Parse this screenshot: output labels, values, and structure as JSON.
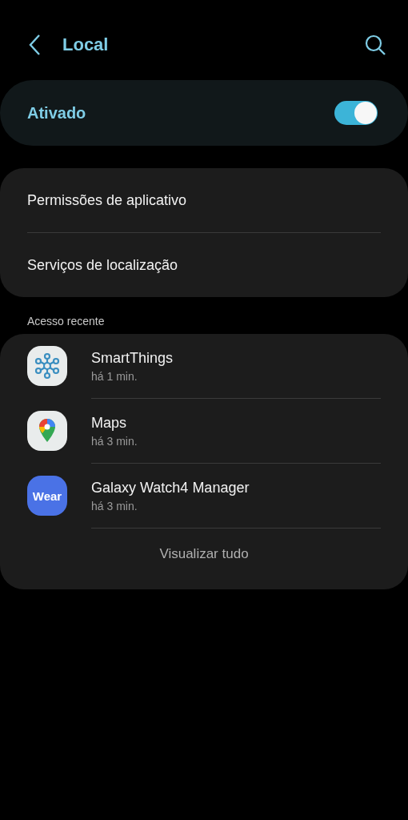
{
  "header": {
    "title": "Local"
  },
  "master": {
    "label": "Ativado",
    "on": true
  },
  "settings": [
    {
      "label": "Permissões de aplicativo"
    },
    {
      "label": "Serviços de localização"
    }
  ],
  "recent": {
    "heading": "Acesso recente",
    "apps": [
      {
        "kind": "smartthings",
        "name": "SmartThings",
        "time": "há 1 min."
      },
      {
        "kind": "maps",
        "name": "Maps",
        "time": "há 3 min."
      },
      {
        "kind": "wear",
        "icon_text": "Wear",
        "name": "Galaxy Watch4 Manager",
        "time": "há 3 min."
      }
    ],
    "view_all": "Visualizar tudo"
  }
}
